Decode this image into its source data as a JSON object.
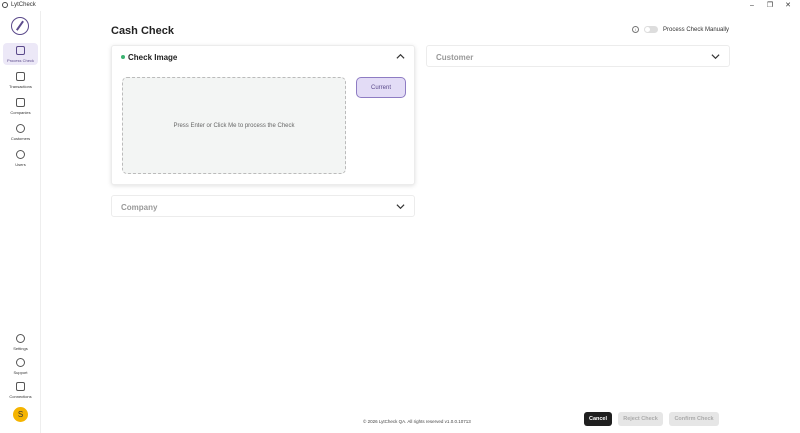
{
  "window": {
    "title": "LytCheck",
    "controls": {
      "minimize": "–",
      "restore": "❐",
      "close": "✕"
    }
  },
  "sidebar": {
    "items": [
      {
        "label": "Process Check",
        "icon": "scanner-icon",
        "active": true
      },
      {
        "label": "Transactions",
        "icon": "transactions-icon"
      },
      {
        "label": "Companies",
        "icon": "companies-icon"
      },
      {
        "label": "Customers",
        "icon": "customers-icon"
      },
      {
        "label": "Users",
        "icon": "users-icon"
      }
    ],
    "bottom_items": [
      {
        "label": "Settings",
        "icon": "gear-icon"
      },
      {
        "label": "Support",
        "icon": "headset-icon"
      },
      {
        "label": "Connections",
        "icon": "connections-icon"
      }
    ],
    "avatar_letter": "S",
    "avatar_color": "#f5b400"
  },
  "header": {
    "title": "Cash Check",
    "info_icon": "i",
    "manual_label": "Process Check Manually"
  },
  "check_image": {
    "title": "Check Image",
    "status_color": "#3cb371",
    "dropzone_text": "Press Enter or Click Me to process the Check",
    "current_label": "Current"
  },
  "customer": {
    "title": "Customer"
  },
  "company": {
    "title": "Company"
  },
  "footer": {
    "copyright": "© 2026 LytCheck QA. All rights reserved v1.0.0.10713",
    "cancel_label": "Cancel",
    "reject_label": "Reject Check",
    "confirm_label": "Confirm Check"
  },
  "colors": {
    "accent": "#5b4a8b",
    "accent_light": "#e3dcf6",
    "primary_button": "#1f1f1f"
  }
}
